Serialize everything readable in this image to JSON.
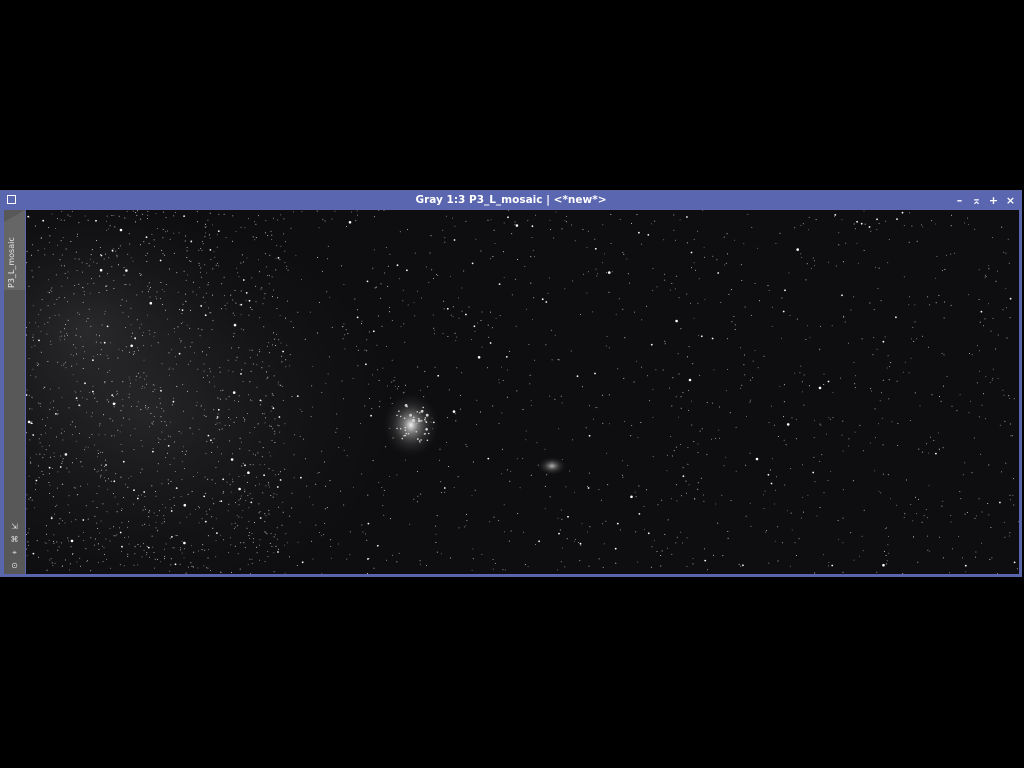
{
  "window": {
    "title": "Gray 1:3 P3_L_mosaic | <*new*>",
    "side_tab_label": "P3_L_mosaic",
    "controls": {
      "minimize": "–",
      "shade": "⌅",
      "maximize": "+",
      "close": "×"
    }
  },
  "image": {
    "description_type": "grayscale astrophotograph",
    "colors": {
      "sky": "#0d0d0f",
      "titlebar": "#5a66b0"
    }
  }
}
